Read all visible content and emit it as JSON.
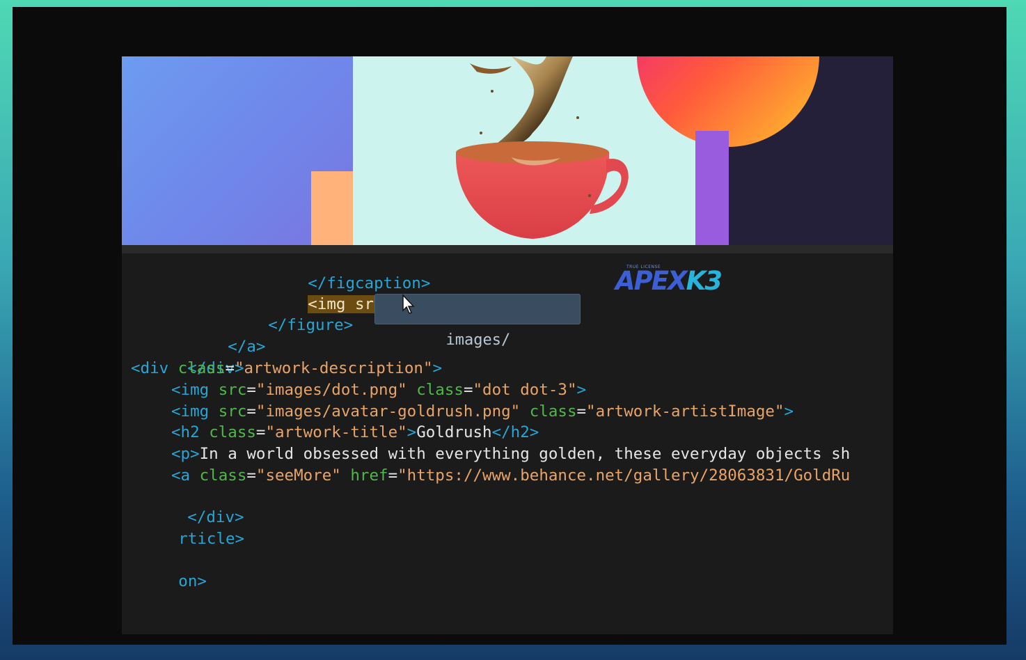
{
  "logo": {
    "small_text": "TRUE LICENSE",
    "brand_a": "APEX",
    "brand_b": "K3"
  },
  "autocomplete": {
    "suggestion": "images/"
  },
  "code": {
    "l1_tag": "</figcaption>",
    "l2_full": "<img src=\"ima\">",
    "l3_tag": "</figure>",
    "l4_tag": "</a>",
    "l5_tag": "</div>",
    "l6_open": "<div ",
    "l6_attr": "class",
    "l6_eq": "=",
    "l6_val": "\"artwork-description\"",
    "l6_close": ">",
    "l7_open": "<img ",
    "l7_attr1": "src",
    "l7_val1": "\"images/dot.png\"",
    "l7_attr2": "class",
    "l7_val2": "\"dot dot-3\"",
    "l7_close": ">",
    "l8_open": "<img ",
    "l8_attr1": "src",
    "l8_val1": "\"images/avatar-goldrush.png\"",
    "l8_attr2": "class",
    "l8_val2": "\"artwork-artistImage\"",
    "l8_close": ">",
    "l9_open": "<h2 ",
    "l9_attr": "class",
    "l9_val": "\"artwork-title\"",
    "l9_gt": ">",
    "l9_text": "Goldrush",
    "l9_close": "</h2>",
    "l10_open": "<p>",
    "l10_text": "In a world obsessed with everything golden, these everyday objects sh",
    "l11_open": "<a ",
    "l11_attr1": "class",
    "l11_val1": "\"seeMore\"",
    "l11_attr2": "href",
    "l11_val2": "\"https://www.behance.net/gallery/28063831/GoldRu",
    "l12_tag": "</div>",
    "l13_tag": "rticle>",
    "l14_tag": "on>"
  }
}
